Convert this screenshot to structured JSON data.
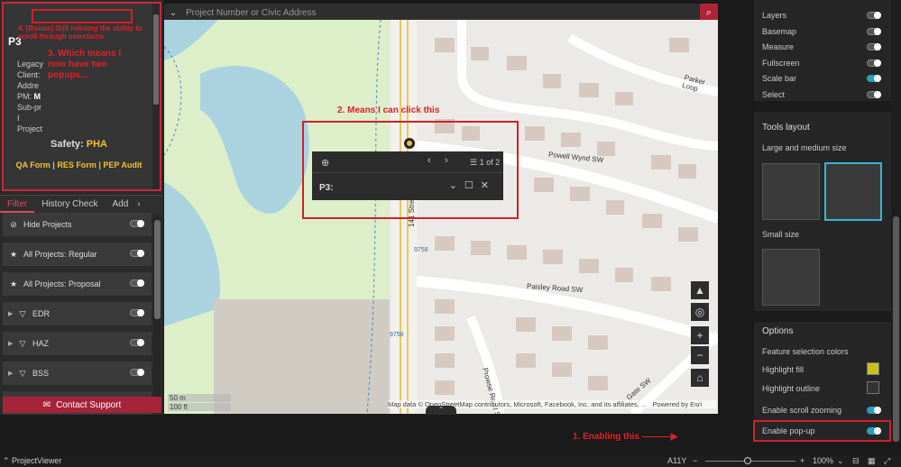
{
  "colors": {
    "accent": "#2a9fbf",
    "brand": "#a5243a",
    "annotation": "#e0202a",
    "gold": "#f2c12e",
    "map_park": "#dcefc8",
    "map_water": "#aad3df"
  },
  "popup_card": {
    "title": "P3",
    "fields": [
      {
        "label": "Legacy",
        "value": ""
      },
      {
        "label": "Client:",
        "value": ""
      },
      {
        "label": "Addre",
        "value": ""
      },
      {
        "label": "PM:",
        "value": "M"
      },
      {
        "label": "Sub-pr",
        "value": ""
      },
      {
        "label": "I",
        "value": ""
      },
      {
        "label": "Project",
        "value": ""
      }
    ],
    "safety_label": "Safety:",
    "safety_value": "PHA",
    "forms_text": "QA Form | RES Form | PEP Audit"
  },
  "annotations": {
    "a4": "4. [Bonus] Still missing the ability to scroll through selections",
    "a3": "3. Which means I now have two popups...",
    "a2": "2. Means I can click this",
    "a1": "1. Enabling this"
  },
  "tabs": [
    {
      "label": "Filter",
      "active": true
    },
    {
      "label": "History Check",
      "active": false
    },
    {
      "label": "Add",
      "active": false
    }
  ],
  "layers": [
    {
      "label": "Hide Projects",
      "icon": "eye-off-icon",
      "caret": false,
      "glyph": "⊘"
    },
    {
      "label": "All Projects: Regular",
      "icon": "star-icon",
      "caret": false,
      "glyph": "★"
    },
    {
      "label": "All Projects: Proposal",
      "icon": "star-icon",
      "caret": false,
      "glyph": "★"
    },
    {
      "label": "EDR",
      "icon": "filter-icon",
      "caret": true,
      "glyph": "▽"
    },
    {
      "label": "HAZ",
      "icon": "filter-icon",
      "caret": true,
      "glyph": "▽"
    },
    {
      "label": "BSS",
      "icon": "filter-icon",
      "caret": true,
      "glyph": "▽"
    },
    {
      "label": "IEQ",
      "icon": "filter-icon",
      "caret": true,
      "glyph": "▽"
    }
  ],
  "contact_label": "Contact Support",
  "search": {
    "placeholder": "Project Number or Civic Address"
  },
  "map_popup": {
    "count": "1 of 2",
    "title": "P3:"
  },
  "map": {
    "streets": [
      "Parker Loop",
      "Powell Wynd SW",
      "141 Street SW",
      "Paisley Road SW",
      "Prowse Road SW",
      "Gate SW"
    ],
    "addresses": [
      "9758",
      "9758"
    ],
    "scale": [
      "50 m",
      "100 ft"
    ],
    "attribution": "Map data © OpenStreetMap contributors, Microsoft, Facebook, Inc. and its affiliates, ...",
    "powered": "Powered by Esri"
  },
  "right_panel": {
    "items_top": [
      {
        "label": "Layers",
        "on": false
      },
      {
        "label": "Basemap",
        "on": false
      },
      {
        "label": "Measure",
        "on": false
      },
      {
        "label": "Fullscreen",
        "on": false
      },
      {
        "label": "Scale bar",
        "on": true
      },
      {
        "label": "Select",
        "on": false
      }
    ],
    "tools_layout": "Tools layout",
    "large_medium": "Large and medium size",
    "small": "Small size",
    "options": "Options",
    "feature_colors": "Feature selection colors",
    "highlight_fill": "Highlight fill",
    "highlight_fill_color": "#c8c020",
    "highlight_outline": "Highlight outline",
    "highlight_outline_color": "#333333",
    "enable_scroll": "Enable scroll zooming",
    "enable_popup": "Enable pop-up"
  },
  "status": {
    "app": "ProjectViewer",
    "a11y": "A11Y",
    "zoom": "100%"
  }
}
